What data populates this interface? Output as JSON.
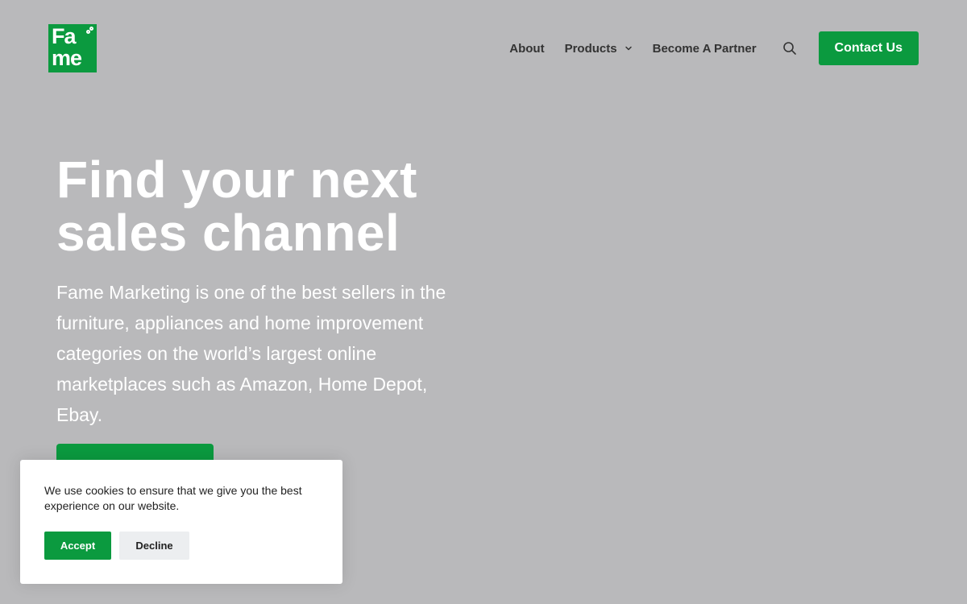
{
  "brand": {
    "logo_line1": "Fa",
    "logo_line2": "me",
    "color": "#0b9a3f"
  },
  "nav": {
    "items": [
      {
        "label": "About",
        "icon": null
      },
      {
        "label": "Products",
        "icon": "chevron-down-icon"
      },
      {
        "label": "Become A Partner",
        "icon": null
      }
    ],
    "search_icon": "search-icon",
    "contact_label": "Contact Us"
  },
  "hero": {
    "title_line1": "Find your next",
    "title_line2": "sales channel",
    "description": "Fame Marketing is one of the best sellers in the furniture, appliances and home improvement categories on the world’s largest online marketplaces such as Amazon, Home Depot, Ebay."
  },
  "cookie": {
    "message": "We use cookies to ensure that we give you the best experience on our website.",
    "accept_label": "Accept",
    "decline_label": "Decline"
  },
  "colors": {
    "overlay_background": "#b9b9bb",
    "accent": "#0b9a3f",
    "nav_text": "#333333",
    "decline_bg": "#eceef0"
  }
}
